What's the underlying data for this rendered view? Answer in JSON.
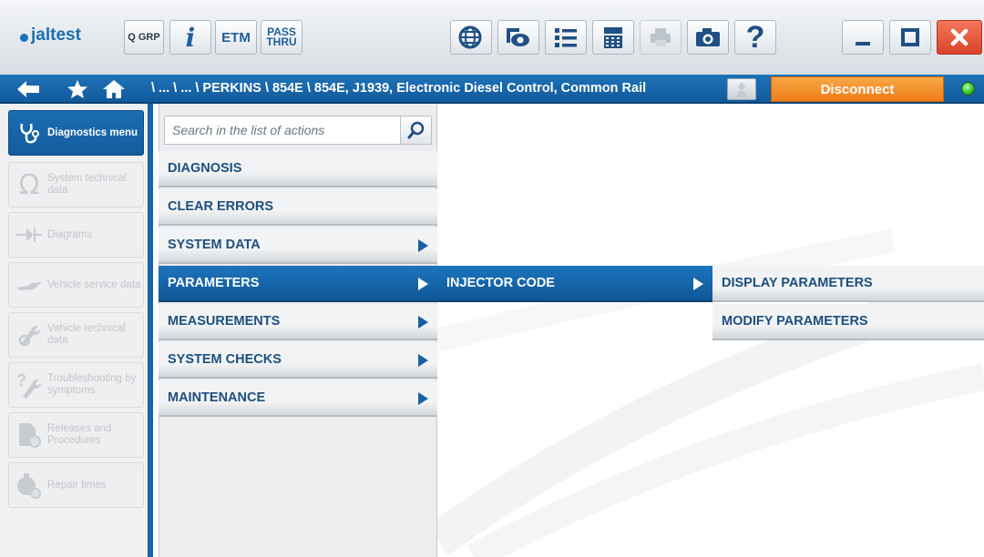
{
  "app": {
    "logo_text": "jaltest"
  },
  "toolbar": {
    "grp_label": "Q GRP",
    "info_label": "i",
    "etm_label": "ETM",
    "passthru_line1": "PASS",
    "passthru_line2": "THRU",
    "help_label": "?"
  },
  "nav": {
    "breadcrumb": "\\ ... \\ ... \\ PERKINS \\ 854E \\ 854E, J1939, Electronic Diesel Control, Common Rail",
    "disconnect_label": "Disconnect"
  },
  "sidebar": {
    "items": [
      {
        "label": "Diagnostics menu",
        "icon": "stethoscope-icon",
        "active": true
      },
      {
        "label": "System technical data",
        "icon": "ohm-icon",
        "active": false
      },
      {
        "label": "Diagrams",
        "icon": "diode-icon",
        "active": false
      },
      {
        "label": "Vehicle service data",
        "icon": "oil-can-icon",
        "active": false
      },
      {
        "label": "Vehicle technical data",
        "icon": "wrench-gear-icon",
        "active": false
      },
      {
        "label": "Troubleshooting by symptoms",
        "icon": "troubleshoot-icon",
        "active": false
      },
      {
        "label": "Releases and Procedures",
        "icon": "document-gear-icon",
        "active": false
      },
      {
        "label": "Repair times",
        "icon": "stopwatch-icon",
        "active": false
      }
    ]
  },
  "search": {
    "placeholder": "Search in the list of actions"
  },
  "actions": {
    "items": [
      {
        "label": "DIAGNOSIS",
        "has_submenu": false
      },
      {
        "label": "CLEAR ERRORS",
        "has_submenu": false
      },
      {
        "label": "SYSTEM DATA",
        "has_submenu": true
      },
      {
        "label": "PARAMETERS",
        "has_submenu": true,
        "selected": true
      },
      {
        "label": "MEASUREMENTS",
        "has_submenu": true
      },
      {
        "label": "SYSTEM CHECKS",
        "has_submenu": true
      },
      {
        "label": "MAINTENANCE",
        "has_submenu": true
      }
    ]
  },
  "submenu": {
    "items": [
      {
        "label": "INJECTOR CODE",
        "has_submenu": true,
        "selected": true
      }
    ]
  },
  "submenu2": {
    "items": [
      {
        "label": "DISPLAY PARAMETERS",
        "has_submenu": false
      },
      {
        "label": "MODIFY PARAMETERS",
        "has_submenu": false
      }
    ]
  },
  "colors": {
    "accent_blue": "#1664aa",
    "disconnect_orange": "#f28a22",
    "status_led": "#35c22a",
    "close_red": "#e04a2f"
  }
}
